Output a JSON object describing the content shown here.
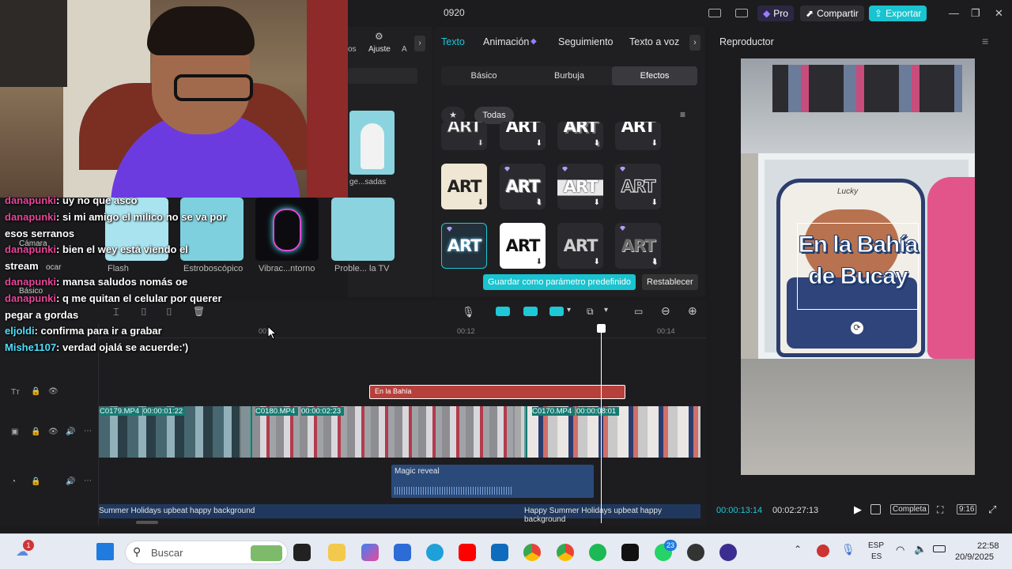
{
  "titlebar": {
    "project_name": "0920",
    "pro_label": "Pro",
    "share_label": "Compartir",
    "export_label": "Exportar"
  },
  "left_panel": {
    "tabs": [
      "os",
      "Ajuste",
      "A"
    ],
    "items": [
      {
        "label": "ge...sadas",
        "row": 0
      },
      {
        "label": "Flash",
        "row": 1
      },
      {
        "label": "Estroboscópico",
        "row": 1
      },
      {
        "label": "Vibrac...ntorno",
        "row": 1
      },
      {
        "label": "Proble... la TV",
        "row": 1
      }
    ],
    "side_labels": [
      "Cámara",
      "Básico",
      "ocar"
    ]
  },
  "text_panel": {
    "tabs": [
      "Texto",
      "Animación",
      "Seguimiento",
      "Texto a voz"
    ],
    "active_tab": "Texto",
    "segments": [
      "Básico",
      "Burbuja",
      "Efectos"
    ],
    "active_segment": "Efectos",
    "filter_all": "Todas",
    "tile_text": "ART",
    "save_preset": "Guardar como parámetro predefinido",
    "reset": "Restablecer"
  },
  "player": {
    "title": "Reproductor",
    "overlay_line1": "En la Bahía",
    "overlay_line2": "de Bucay",
    "bag_text": "Lucky",
    "current_time": "00:00:13:14",
    "total_time": "00:02:27:13",
    "quality": "Completa",
    "ratio": "9:16"
  },
  "timeline": {
    "ruler_labels": [
      "00:",
      "00:12",
      "00:14"
    ],
    "text_clip": "En la Bahía",
    "video_clips": [
      {
        "name": "C0179.MP4",
        "duration": "00:00:01:22"
      },
      {
        "name": "C0180.MP4",
        "duration": "00:00:02:23"
      },
      {
        "name": "C0170.MP4",
        "duration": "00:00:08:01"
      }
    ],
    "sfx_clip": "Magic reveal",
    "music_clip_1": "Summer Holidays upbeat happy background",
    "music_clip_2": "Happy Summer Holidays upbeat happy background"
  },
  "chat": [
    {
      "user": "danapunki",
      "msg": "uy no que asco"
    },
    {
      "user": "danapunki",
      "msg": "si mi amigo el milico no se va por"
    },
    {
      "user": "",
      "msg": "esos serranos"
    },
    {
      "user": "danapunki",
      "msg": "bien el wey está viendo el"
    },
    {
      "user": "",
      "msg": "stream"
    },
    {
      "user": "danapunki",
      "msg": "mansa saludos nomás oe"
    },
    {
      "user": "danapunki",
      "msg": "q me quitan el celular por querer"
    },
    {
      "user": "",
      "msg": "pegar a gordas"
    },
    {
      "user": "eljoldi",
      "msg": "confirma para ir a grabar"
    },
    {
      "user": "Mishe1107",
      "msg": "verdad ojalá se acuerde:')"
    }
  ],
  "taskbar": {
    "search_placeholder": "Buscar",
    "notif_count": "1",
    "whatsapp_count": "23",
    "lang_line1": "ESP",
    "lang_line2": "ES",
    "time": "22:58",
    "date": "20/9/2025"
  },
  "colors": {
    "accent": "#1ec8d6",
    "pro": "#9b7bff",
    "export": "#19c3cf",
    "text_clip": "#b5403c",
    "video_track": "#157a72",
    "audio_track": "#2a4a7a"
  }
}
